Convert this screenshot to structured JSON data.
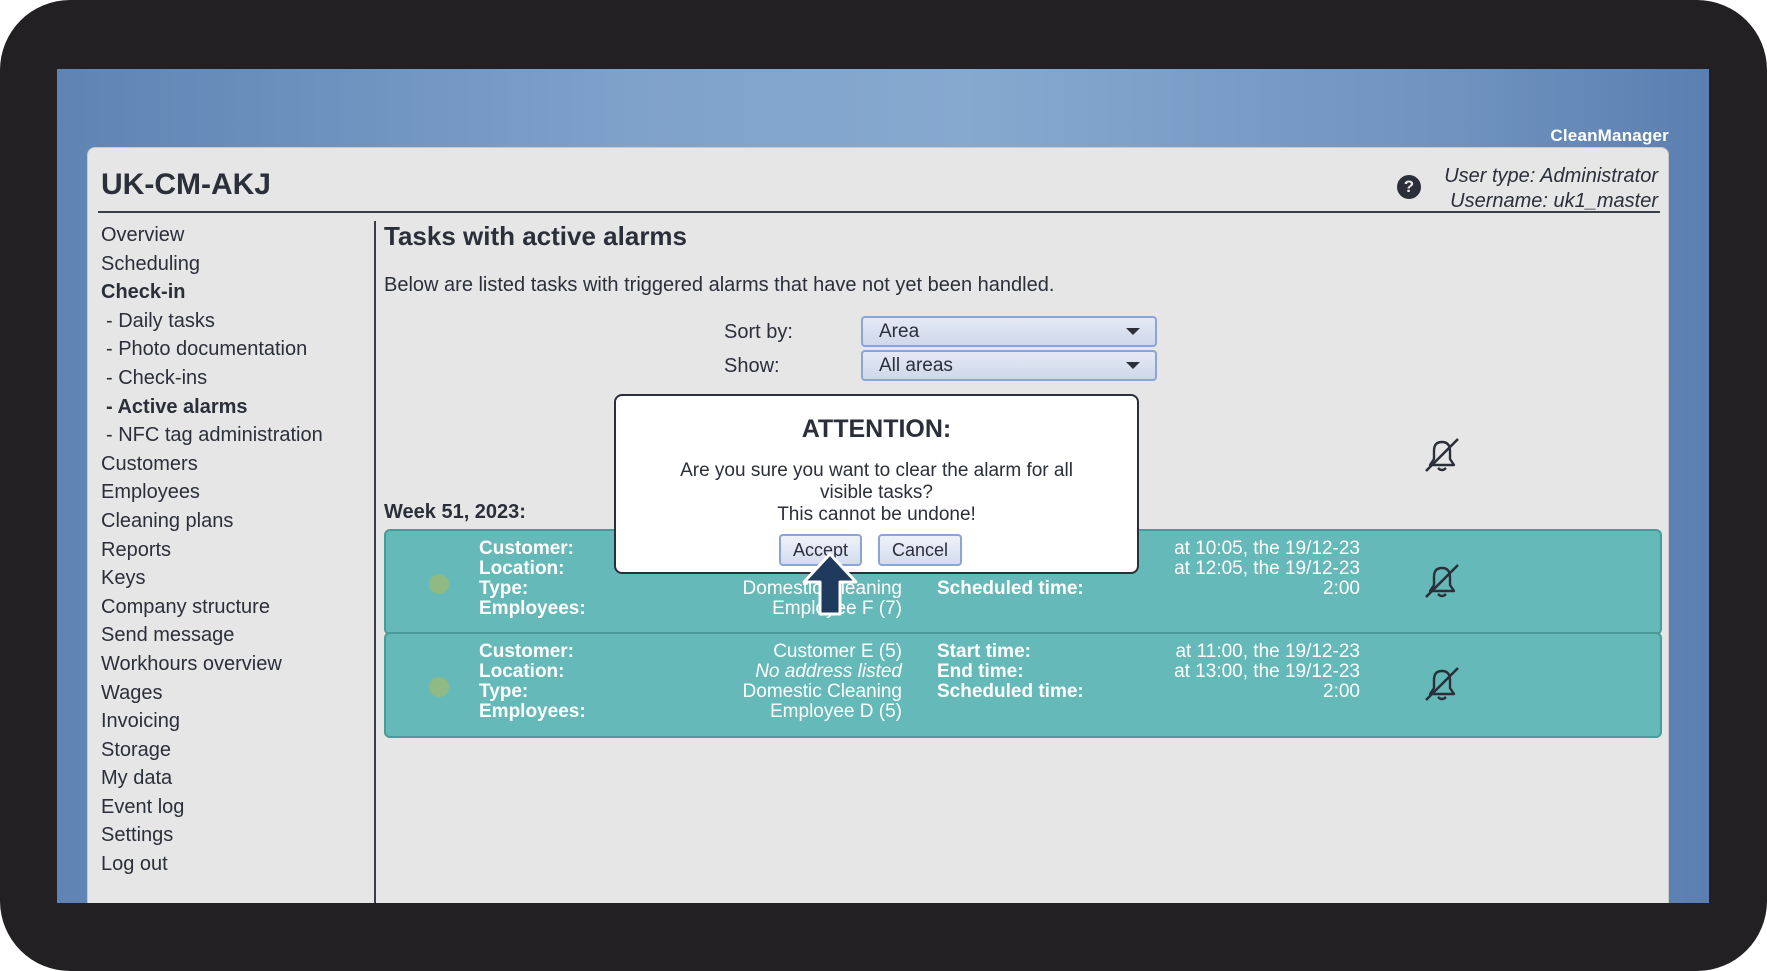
{
  "brand": "CleanManager",
  "header": {
    "app_title": "UK-CM-AKJ",
    "user_type": "User type: Administrator",
    "username": "Username: uk1_master"
  },
  "sidebar": {
    "items": [
      {
        "label": "Overview",
        "bold": false,
        "sub": false
      },
      {
        "label": "Scheduling",
        "bold": false,
        "sub": false
      },
      {
        "label": "Check-in",
        "bold": true,
        "sub": false
      },
      {
        "label": "- Daily tasks",
        "bold": false,
        "sub": true
      },
      {
        "label": "- Photo documentation",
        "bold": false,
        "sub": true
      },
      {
        "label": "- Check-ins",
        "bold": false,
        "sub": true
      },
      {
        "label": "- Active alarms",
        "bold": true,
        "sub": true
      },
      {
        "label": "- NFC tag administration",
        "bold": false,
        "sub": true
      },
      {
        "label": "Customers",
        "bold": false,
        "sub": false
      },
      {
        "label": "Employees",
        "bold": false,
        "sub": false
      },
      {
        "label": "Cleaning plans",
        "bold": false,
        "sub": false
      },
      {
        "label": "Reports",
        "bold": false,
        "sub": false
      },
      {
        "label": "Keys",
        "bold": false,
        "sub": false
      },
      {
        "label": "Company structure",
        "bold": false,
        "sub": false
      },
      {
        "label": "Send message",
        "bold": false,
        "sub": false
      },
      {
        "label": "Workhours overview",
        "bold": false,
        "sub": false
      },
      {
        "label": "Wages",
        "bold": false,
        "sub": false
      },
      {
        "label": "Invoicing",
        "bold": false,
        "sub": false
      },
      {
        "label": "Storage",
        "bold": false,
        "sub": false
      },
      {
        "label": "My data",
        "bold": false,
        "sub": false
      },
      {
        "label": "Event log",
        "bold": false,
        "sub": false
      },
      {
        "label": "Settings",
        "bold": false,
        "sub": false
      },
      {
        "label": "Log out",
        "bold": false,
        "sub": false
      }
    ]
  },
  "main": {
    "title": "Tasks with active alarms",
    "description": "Below are listed tasks with triggered alarms that have not yet been handled.",
    "sort_label": "Sort by:",
    "sort_value": "Area",
    "show_label": "Show:",
    "show_value": "All areas",
    "week_label": "Week 51, 2023:",
    "tasks": [
      {
        "customer_label": "Customer:",
        "customer": "",
        "location_label": "Location:",
        "location": "",
        "type_label": "Type:",
        "type": "Domestic Cleaning",
        "employees_label": "Employees:",
        "employees": "Employee F (7)",
        "start_label": "",
        "start": "at 10:05, the 19/12-23",
        "end_label": "",
        "end": "at 12:05, the 19/12-23",
        "scheduled_label": "Scheduled time:",
        "scheduled": "2:00"
      },
      {
        "customer_label": "Customer:",
        "customer": "Customer E (5)",
        "location_label": "Location:",
        "location": "No address listed",
        "type_label": "Type:",
        "type": "Domestic Cleaning",
        "employees_label": "Employees:",
        "employees": "Employee D (5)",
        "start_label": "Start time:",
        "start": "at 11:00, the 19/12-23",
        "end_label": "End time:",
        "end": "at 13:00, the 19/12-23",
        "scheduled_label": "Scheduled time:",
        "scheduled": "2:00"
      }
    ]
  },
  "dialog": {
    "title": "ATTENTION:",
    "line1": "Are you sure you want to clear the alarm for all visible tasks?",
    "line2": "This cannot be undone!",
    "accept_label": "Accept",
    "cancel_label": "Cancel"
  },
  "icons": {
    "help": "question-circle-icon",
    "bell_off": "bell-slash-icon",
    "pointer": "arrow-up-icon"
  },
  "colors": {
    "card": "#65b9b8",
    "accent": "#8aa6d6",
    "text": "#2b2f3a",
    "pointer": "#1e3a5c"
  }
}
